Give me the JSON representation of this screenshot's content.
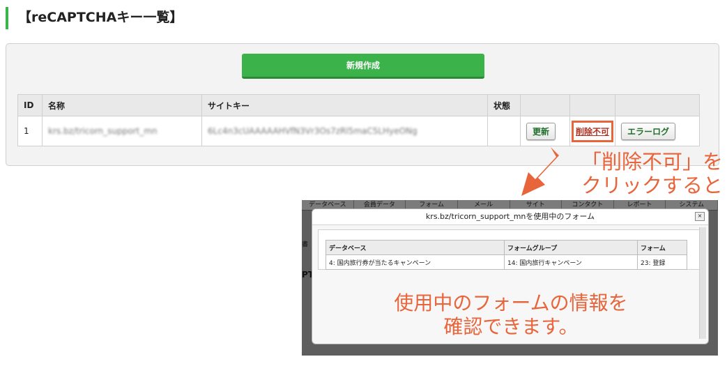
{
  "heading": "【reCAPTCHAキー一覧】",
  "new_button": "新規作成",
  "table": {
    "headers": [
      "ID",
      "名称",
      "サイトキー",
      "状態",
      "",
      "",
      ""
    ],
    "rows": [
      {
        "id": "1",
        "name": "krs.bz/tricorn_support_mn",
        "site_key": "6Lc4n3cUAAAAAHVfN3Vr3Os7zRl5maC5LHyeONg",
        "status": "",
        "update_label": "更新",
        "delete_label": "削除不可",
        "error_log_label": "エラーログ"
      }
    ]
  },
  "annotation_top": [
    "「削除不可」を",
    "クリックすると"
  ],
  "inset": {
    "nav": [
      "データベース",
      "会員データ",
      "フォーム",
      "メール",
      "サイト",
      "コンタクト",
      "レポート",
      "システム"
    ],
    "side_hints": [
      "書",
      "PT("
    ],
    "modal_title": "krs.bz/tricorn_support_mnを使用中のフォーム",
    "close_label": "×",
    "forms_headers": [
      "データベース",
      "フォームグループ",
      "フォーム"
    ],
    "forms_rows": [
      [
        "4: 国内旅行券が当たるキャンペーン",
        "14: 国内旅行キャンペーン",
        "23: 登録"
      ]
    ],
    "annotation_bottom": [
      "使用中のフォームの情報を",
      "確認できます。"
    ]
  },
  "colors": {
    "accent_green": "#3cb34a",
    "annotation_orange": "#e8643a",
    "delete_red": "#b23020"
  }
}
